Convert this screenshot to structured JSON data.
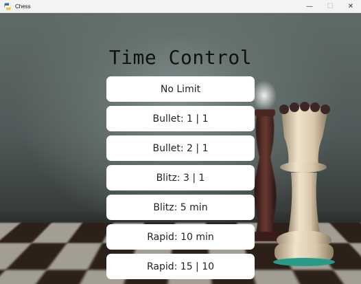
{
  "window": {
    "title": "Chess",
    "minimize_glyph": "—",
    "maximize_glyph": "☐",
    "close_glyph": "✕"
  },
  "screen": {
    "heading": "Time Control"
  },
  "time_controls": [
    {
      "label": "No Limit"
    },
    {
      "label": "Bullet: 1 | 1"
    },
    {
      "label": "Bullet: 2 | 1"
    },
    {
      "label": "Blitz: 3 | 1"
    },
    {
      "label": "Blitz: 5 min"
    },
    {
      "label": "Rapid: 10 min"
    },
    {
      "label": "Rapid: 15 | 10"
    }
  ],
  "icons": {
    "app": "python-icon"
  },
  "colors": {
    "button_bg": "#ffffff",
    "text": "#111111",
    "titlebar": "#f3f3f3"
  }
}
